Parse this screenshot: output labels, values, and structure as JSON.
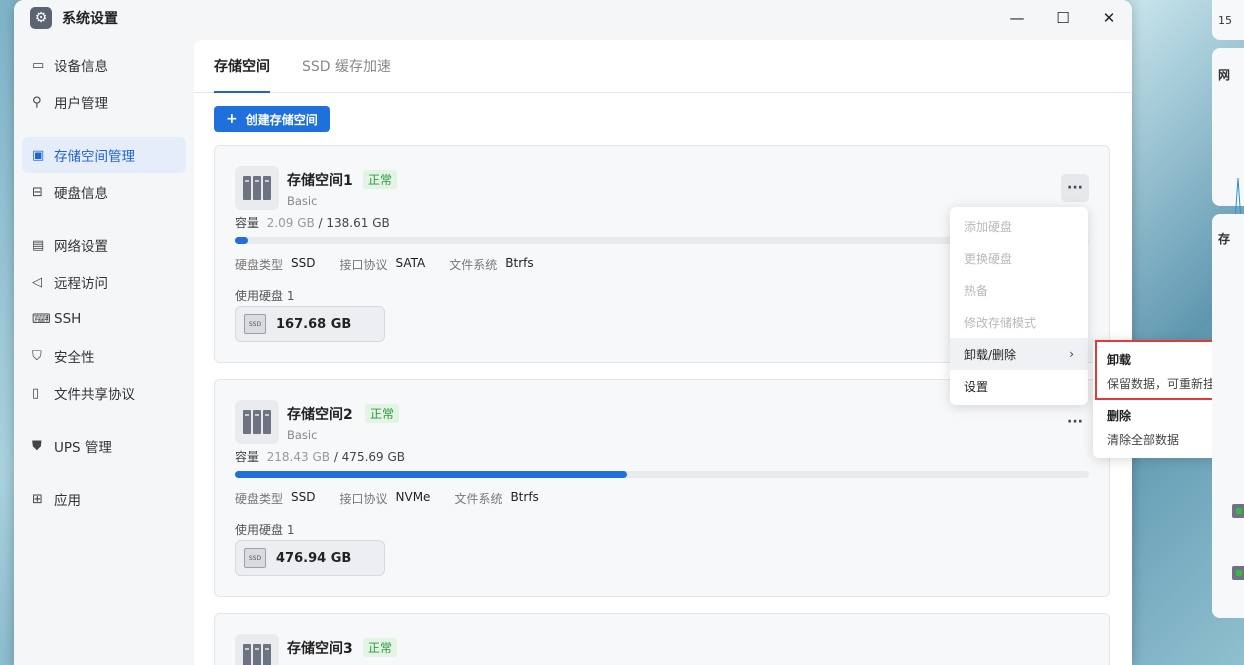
{
  "window": {
    "title": "系统设置"
  },
  "sidebar": {
    "items": [
      {
        "label": "设备信息",
        "icon": "device-icon"
      },
      {
        "label": "用户管理",
        "icon": "user-icon"
      },
      {
        "label": "存储空间管理",
        "icon": "storage-icon",
        "active": true
      },
      {
        "label": "硬盘信息",
        "icon": "disk-icon"
      },
      {
        "label": "网络设置",
        "icon": "network-icon"
      },
      {
        "label": "远程访问",
        "icon": "remote-icon"
      },
      {
        "label": "SSH",
        "icon": "ssh-icon"
      },
      {
        "label": "安全性",
        "icon": "shield-icon"
      },
      {
        "label": "文件共享协议",
        "icon": "file-share-icon"
      },
      {
        "label": "UPS 管理",
        "icon": "ups-icon"
      },
      {
        "label": "应用",
        "icon": "apps-icon"
      }
    ]
  },
  "tabs": [
    {
      "label": "存储空间",
      "active": true
    },
    {
      "label": "SSD 缓存加速",
      "active": false
    }
  ],
  "create_button": {
    "label": "创建存储空间"
  },
  "labels": {
    "capacity": "容量",
    "disk_type": "硬盘类型",
    "interface": "接口协议",
    "filesystem": "文件系统",
    "disks_used": "使用硬盘"
  },
  "pools": [
    {
      "name": "存储空间1",
      "status": "正常",
      "type": "Basic",
      "used": "2.09 GB",
      "total": "138.61 GB",
      "usage_fraction": 0.015,
      "disk_type": "SSD",
      "interface": "SATA",
      "filesystem": "Btrfs",
      "disk_count": "1",
      "disk_size": "167.68 GB"
    },
    {
      "name": "存储空间2",
      "status": "正常",
      "type": "Basic",
      "used": "218.43 GB",
      "total": "475.69 GB",
      "usage_fraction": 0.459,
      "disk_type": "SSD",
      "interface": "NVMe",
      "filesystem": "Btrfs",
      "disk_count": "1",
      "disk_size": "476.94 GB"
    },
    {
      "name": "存储空间3",
      "status": "正常"
    }
  ],
  "context_menu": {
    "items": [
      {
        "label": "添加硬盘",
        "disabled": true
      },
      {
        "label": "更换硬盘",
        "disabled": true
      },
      {
        "label": "热备",
        "disabled": true
      },
      {
        "label": "修改存储模式",
        "disabled": true
      },
      {
        "label": "卸载/删除",
        "disabled": false,
        "has_submenu": true
      },
      {
        "label": "设置",
        "disabled": false
      }
    ]
  },
  "submenu": {
    "items": [
      {
        "title": "卸载",
        "desc": "保留数据，可重新挂载"
      },
      {
        "title": "删除",
        "desc": "清除全部数据"
      }
    ]
  },
  "background_widgets": {
    "top_text": "15",
    "network_title": "网",
    "storage_title": "存"
  },
  "colors": {
    "accent": "#1f6fdc",
    "status_ok": "#2f9a3e",
    "highlight_border": "#e53935"
  }
}
